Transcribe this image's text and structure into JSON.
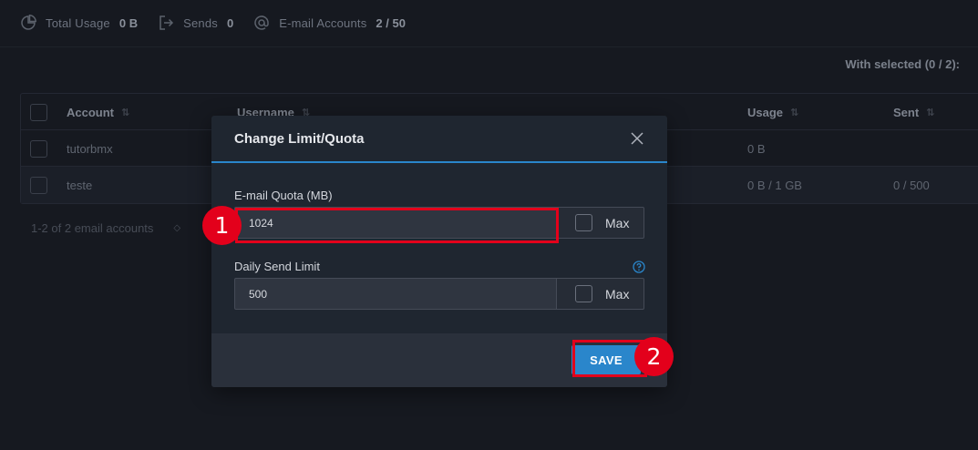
{
  "stats": {
    "total_usage_label": "Total Usage",
    "total_usage_value": "0 B",
    "sends_label": "Sends",
    "sends_value": "0",
    "email_accounts_label": "E-mail Accounts",
    "email_accounts_value": "2 / 50"
  },
  "with_selected": "With selected (0 / 2):",
  "table": {
    "headers": {
      "account": "Account",
      "username": "Username",
      "usage": "Usage",
      "sent": "Sent"
    },
    "rows": [
      {
        "account": "tutorbmx",
        "usage": "0 B",
        "sent": ""
      },
      {
        "account": "teste",
        "usage": "0 B / 1 GB",
        "sent": "0 / 500"
      }
    ]
  },
  "pager": {
    "summary": "1-2 of 2 email accounts"
  },
  "modal": {
    "title": "Change Limit/Quota",
    "quota_label": "E-mail Quota (MB)",
    "quota_value": "1024",
    "max_label": "Max",
    "send_limit_label": "Daily Send Limit",
    "send_limit_value": "500",
    "save_label": "SAVE"
  },
  "annotations": {
    "step1": "1",
    "step2": "2",
    "color": "#e3001b"
  },
  "colors": {
    "accent": "#2a86cb",
    "background": "#161920",
    "modal": "#1f2630"
  },
  "icons": [
    "pie-chart-icon",
    "sign-out-icon",
    "at-sign-icon",
    "sort-icon",
    "close-icon",
    "help-circle-icon"
  ]
}
